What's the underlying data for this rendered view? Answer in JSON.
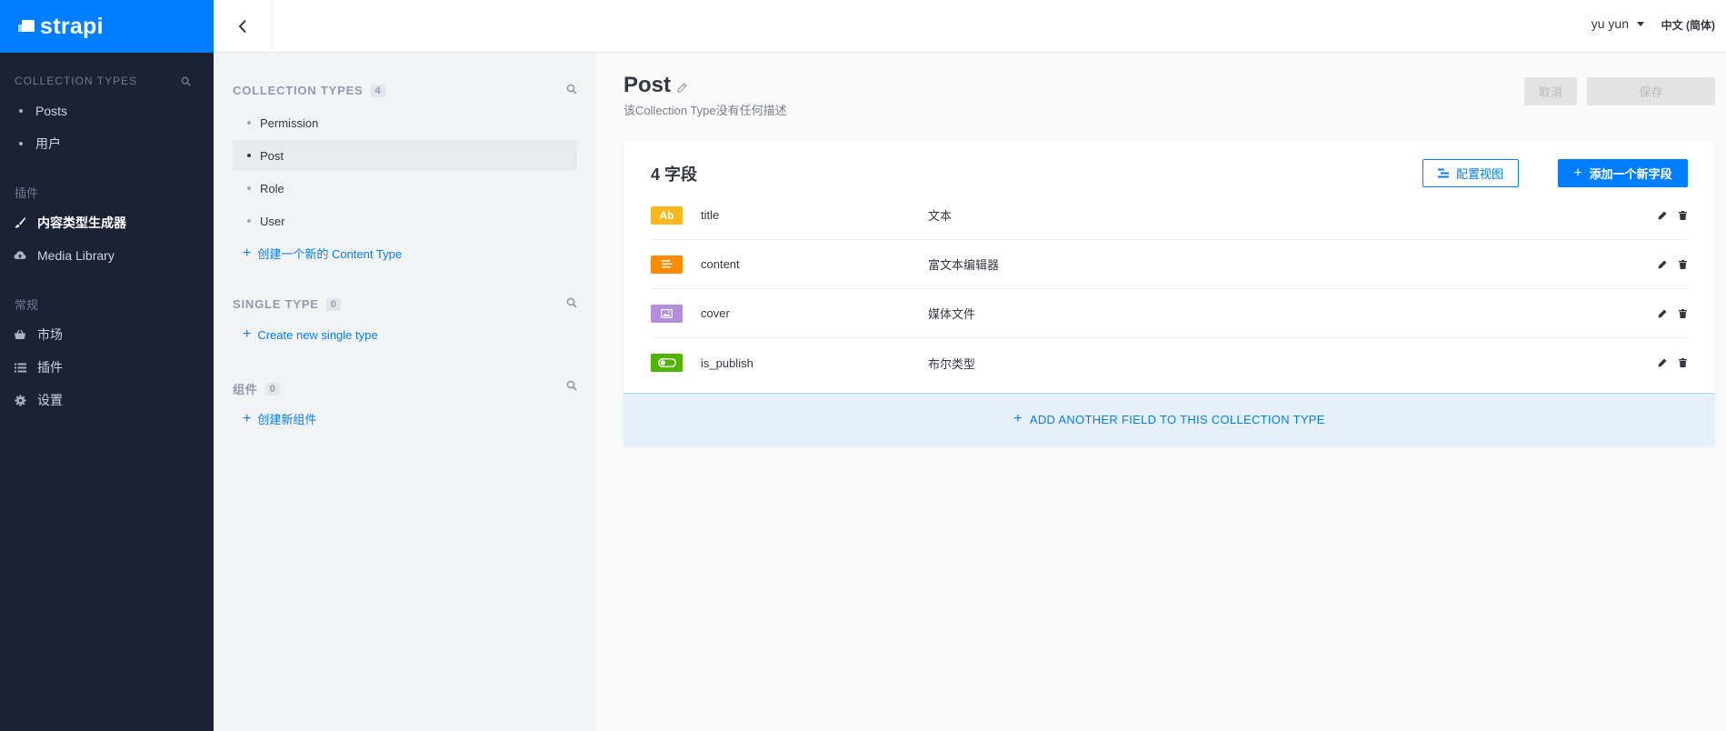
{
  "brand": {
    "name": "strapi"
  },
  "nav": {
    "collection_types_title": "COLLECTION TYPES",
    "collection_items": [
      {
        "label": "Posts"
      },
      {
        "label": "用户"
      }
    ],
    "plugins_title": "插件",
    "plugin_items": [
      {
        "label": "内容类型生成器",
        "icon": "brush-icon",
        "active": true
      },
      {
        "label": "Media Library",
        "icon": "cloud-upload-icon",
        "active": false
      }
    ],
    "general_title": "常规",
    "general_items": [
      {
        "label": "市场",
        "icon": "basket-icon"
      },
      {
        "label": "插件",
        "icon": "list-icon"
      },
      {
        "label": "设置",
        "icon": "gear-icon"
      }
    ]
  },
  "topbar": {
    "user": "yu yun",
    "language": "中文 (简体)"
  },
  "ctb": {
    "collection_types_title": "COLLECTION TYPES",
    "collection_count": "4",
    "collection_items": [
      {
        "label": "Permission",
        "active": false
      },
      {
        "label": "Post",
        "active": true
      },
      {
        "label": "Role",
        "active": false
      },
      {
        "label": "User",
        "active": false
      }
    ],
    "create_collection_label": "创建一个新的 Content Type",
    "single_types_title": "SINGLE TYPE",
    "single_count": "0",
    "create_single_label": "Create new single type",
    "components_title": "组件",
    "components_count": "0",
    "create_component_label": "创建新组件"
  },
  "main": {
    "title": "Post",
    "description": "该Collection Type没有任何描述",
    "cancel_label": "取消",
    "save_label": "保存",
    "fields_count_label": "4 字段",
    "config_view_label": "配置视图",
    "add_field_label": "添加一个新字段",
    "fields": [
      {
        "name": "title",
        "type": "文本",
        "icon": "text-icon",
        "icon_text": "Ab",
        "color": "#fab81e"
      },
      {
        "name": "content",
        "type": "富文本编辑器",
        "icon": "richtext-icon",
        "icon_text": "",
        "color": "#ff8c00"
      },
      {
        "name": "cover",
        "type": "媒体文件",
        "icon": "media-icon",
        "icon_text": "",
        "color": "#b48edc"
      },
      {
        "name": "is_publish",
        "type": "布尔类型",
        "icon": "boolean-icon",
        "icon_text": "",
        "color": "#4fb500"
      }
    ],
    "add_another_label": "ADD ANOTHER FIELD TO THIS COLLECTION TYPE"
  },
  "colors": {
    "accent": "#007eff",
    "sidebar_bg": "#1a2234"
  }
}
